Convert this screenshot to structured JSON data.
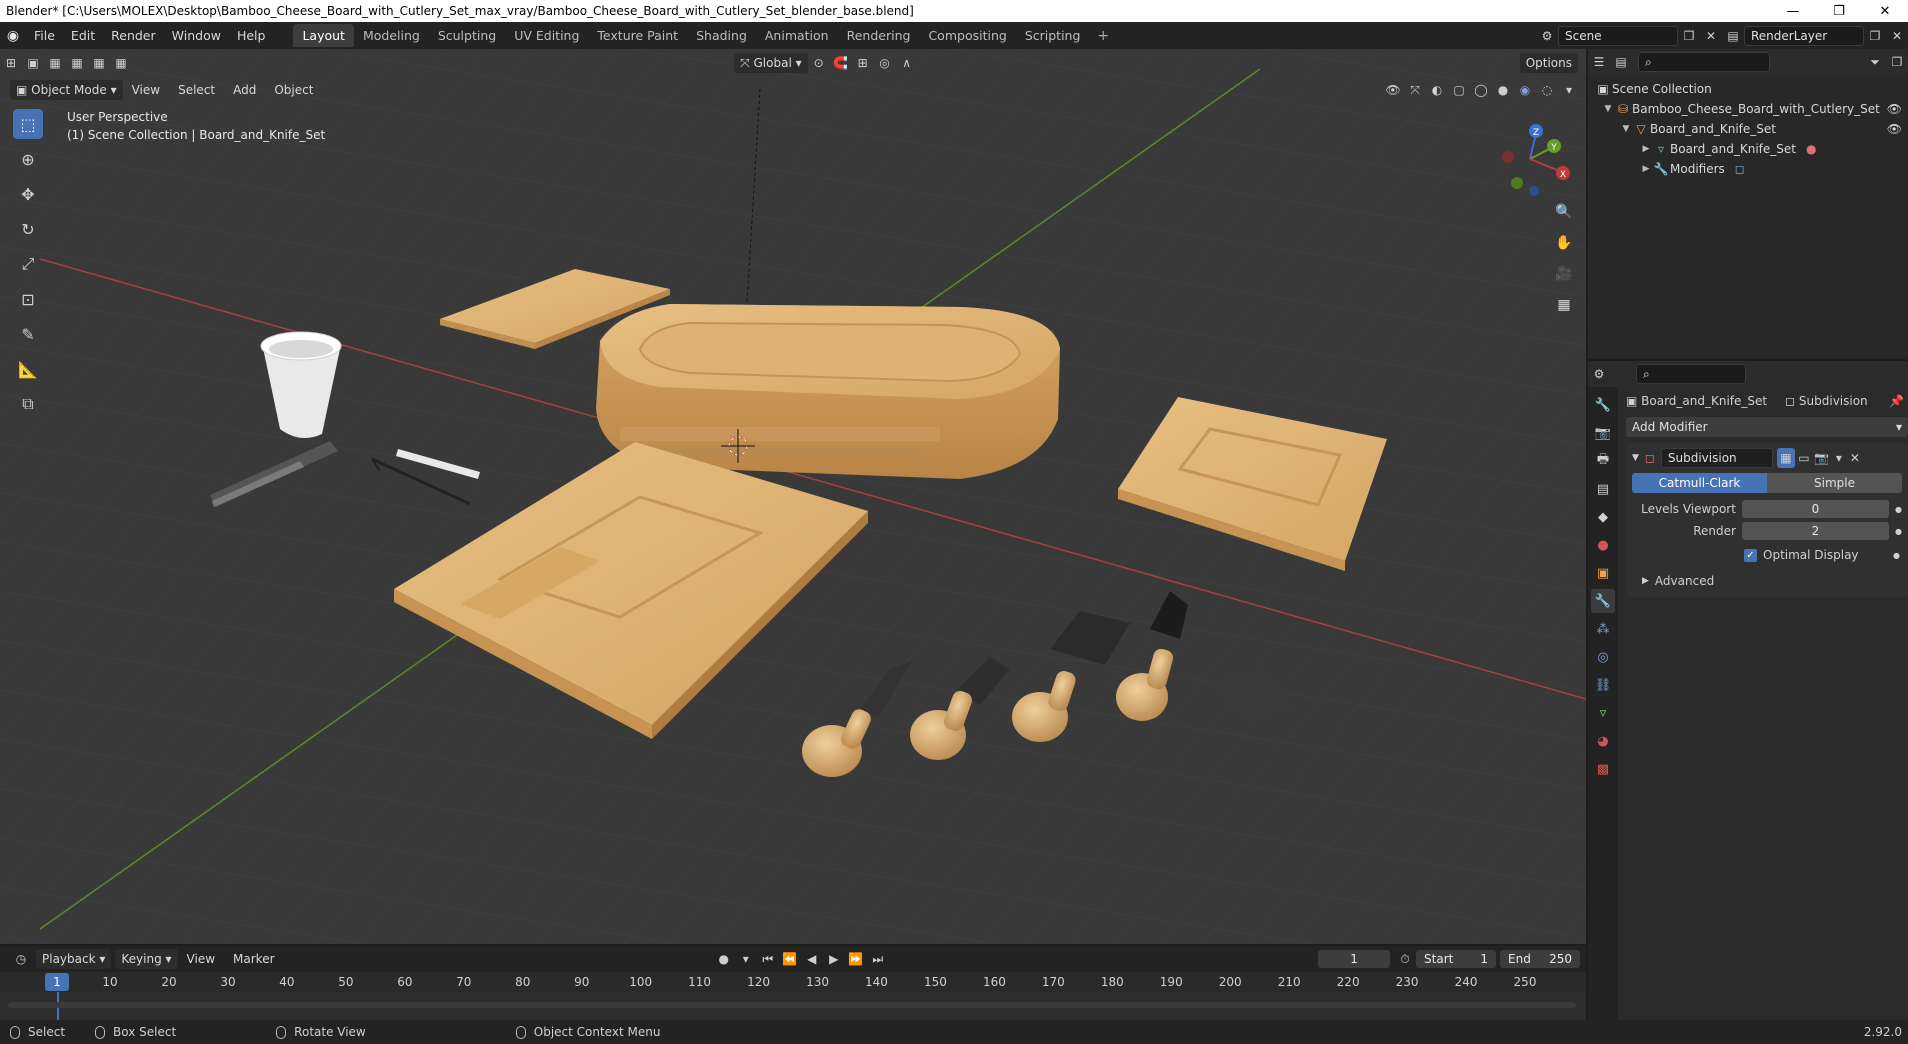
{
  "window": {
    "title": "Blender* [C:\\Users\\MOLEX\\Desktop\\Bamboo_Cheese_Board_with_Cutlery_Set_max_vray/Bamboo_Cheese_Board_with_Cutlery_Set_blender_base.blend]",
    "minimize": "—",
    "restore": "❐",
    "close": "✕"
  },
  "topbar": {
    "menus": [
      "File",
      "Edit",
      "Render",
      "Window",
      "Help"
    ],
    "workspaces": [
      "Layout",
      "Modeling",
      "Sculpting",
      "UV Editing",
      "Texture Paint",
      "Shading",
      "Animation",
      "Rendering",
      "Compositing",
      "Scripting"
    ],
    "active_workspace": "Layout",
    "add_workspace": "+",
    "scene_name": "Scene",
    "view_layer": "RenderLayer"
  },
  "viewport": {
    "mode": "Object Mode",
    "menus": [
      "View",
      "Select",
      "Add",
      "Object"
    ],
    "orientation": "Global",
    "options_label": "Options",
    "perspective_label": "User Perspective",
    "collection_label": "(1) Scene Collection | Board_and_Knife_Set",
    "gizmo": {
      "x": "X",
      "y": "Y",
      "z": "Z"
    }
  },
  "outliner": {
    "root": "Scene Collection",
    "items": [
      {
        "label": "Bamboo_Cheese_Board_with_Cutlery_Set",
        "icon": "collection-icon"
      },
      {
        "label": "Board_and_Knife_Set",
        "icon": "object-icon"
      },
      {
        "label": "Board_and_Knife_Set",
        "icon": "mesh-data-icon"
      },
      {
        "label": "Modifiers",
        "icon": "wrench-icon"
      }
    ]
  },
  "properties": {
    "object_name": "Board_and_Knife_Set",
    "modifier_tab": "Subdivision",
    "add_modifier": "Add Modifier",
    "modifier": {
      "name": "Subdivision",
      "type_options": [
        "Catmull-Clark",
        "Simple"
      ],
      "selected_type": "Catmull-Clark",
      "levels_viewport_label": "Levels Viewport",
      "levels_viewport": "0",
      "render_label": "Render",
      "render_levels": "2",
      "optimal_display_label": "Optimal Display",
      "optimal_display": true,
      "advanced_label": "Advanced"
    }
  },
  "timeline": {
    "menus": [
      "Playback",
      "Keying",
      "View",
      "Marker"
    ],
    "current_frame": "1",
    "start_label": "Start",
    "start": "1",
    "end_label": "End",
    "end": "250",
    "ruler": [
      "1",
      "10",
      "20",
      "30",
      "40",
      "50",
      "60",
      "70",
      "80",
      "90",
      "100",
      "110",
      "120",
      "130",
      "140",
      "150",
      "160",
      "170",
      "180",
      "190",
      "200",
      "210",
      "220",
      "230",
      "240",
      "250"
    ]
  },
  "statusbar": {
    "select": "Select",
    "box_select": "Box Select",
    "rotate_view": "Rotate View",
    "context_menu": "Object Context Menu",
    "version": "2.92.0"
  },
  "colors": {
    "accent": "#4772b3",
    "viewport_bg": "#393939",
    "x_axis": "#c0393b",
    "y_axis": "#6a9b2b",
    "bamboo": "#e2b877"
  }
}
